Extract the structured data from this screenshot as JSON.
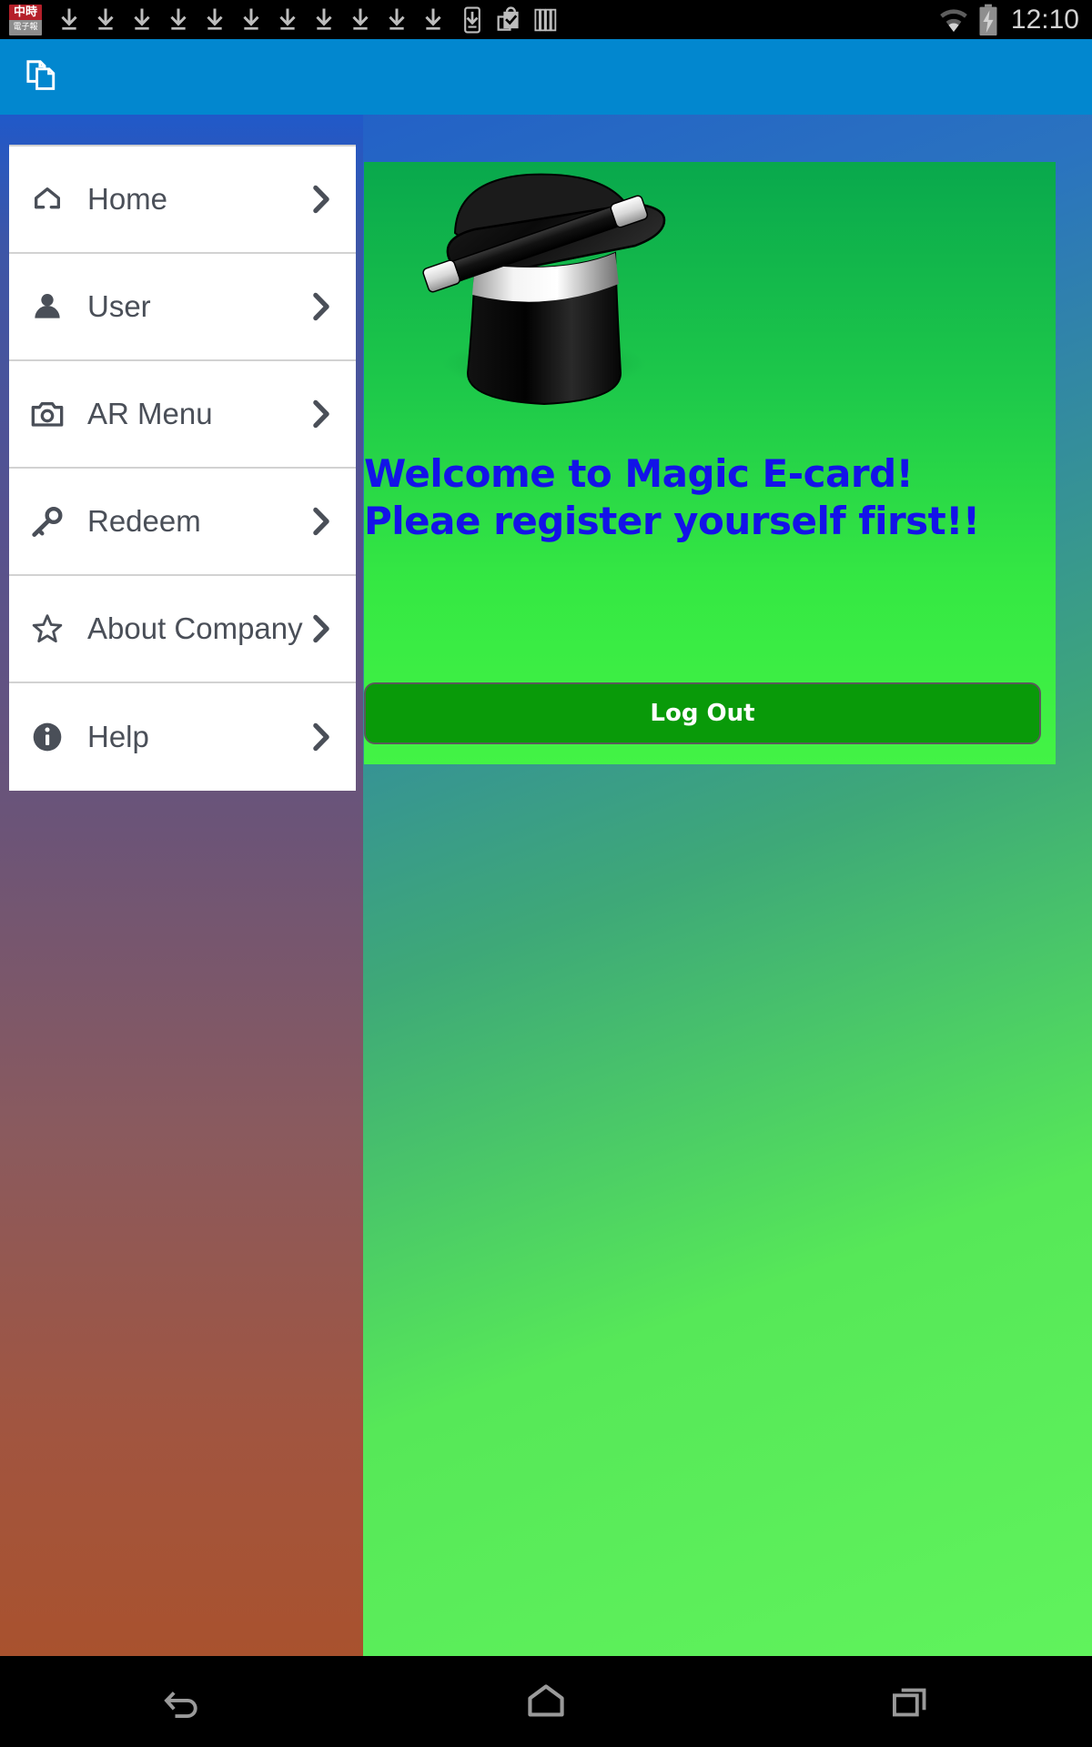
{
  "status_bar": {
    "app_badge": {
      "top_text": "中時",
      "bottom_text": "電子報"
    },
    "download_icon_count": 11,
    "icons": [
      "download-arrow-icon",
      "phone-download-icon",
      "bag-check-icon",
      "cards-stack-icon"
    ],
    "wifi": "wifi-icon",
    "battery": "battery-charging-icon",
    "time": "12:10",
    "background": "#000000",
    "text_color": "#d2d2d2"
  },
  "app_bar": {
    "icon": "copy-pages-icon",
    "title": "",
    "background": "#0287cf"
  },
  "drawer": {
    "background_gradient_top": "#2059c9",
    "background_gradient_bottom": "#a9522e",
    "items": [
      {
        "label": "Home",
        "icon": "home-icon",
        "chevron": "chevron-right-icon"
      },
      {
        "label": "User",
        "icon": "person-icon",
        "chevron": "chevron-right-icon"
      },
      {
        "label": "AR Menu",
        "icon": "camera-icon",
        "chevron": "chevron-right-icon"
      },
      {
        "label": "Redeem",
        "icon": "key-icon",
        "chevron": "chevron-right-icon"
      },
      {
        "label": "About Company",
        "icon": "star-outline-icon",
        "chevron": "chevron-right-icon"
      },
      {
        "label": "Help",
        "icon": "info-icon",
        "chevron": "chevron-right-icon"
      }
    ]
  },
  "main": {
    "card": {
      "image": "magic-top-hat-with-wand",
      "welcome_line_1": "Welcome to Magic E-card!",
      "welcome_line_2": "Pleae register yourself first!!",
      "welcome_text_color": "#1313e8",
      "card_background_top": "#09a84c",
      "card_background_bottom": "#43f345"
    },
    "logout_button": {
      "label": "Log Out",
      "background": "#099a09",
      "text_color": "#ffffff"
    },
    "page_background_top": "#2059c9",
    "page_background_bottom": "#60f35c"
  },
  "nav_bar": {
    "background": "#000000",
    "buttons": [
      {
        "name": "back-button",
        "icon": "back-arrow-icon"
      },
      {
        "name": "home-button",
        "icon": "home-outline-icon"
      },
      {
        "name": "recents-button",
        "icon": "recents-squares-icon"
      }
    ]
  }
}
